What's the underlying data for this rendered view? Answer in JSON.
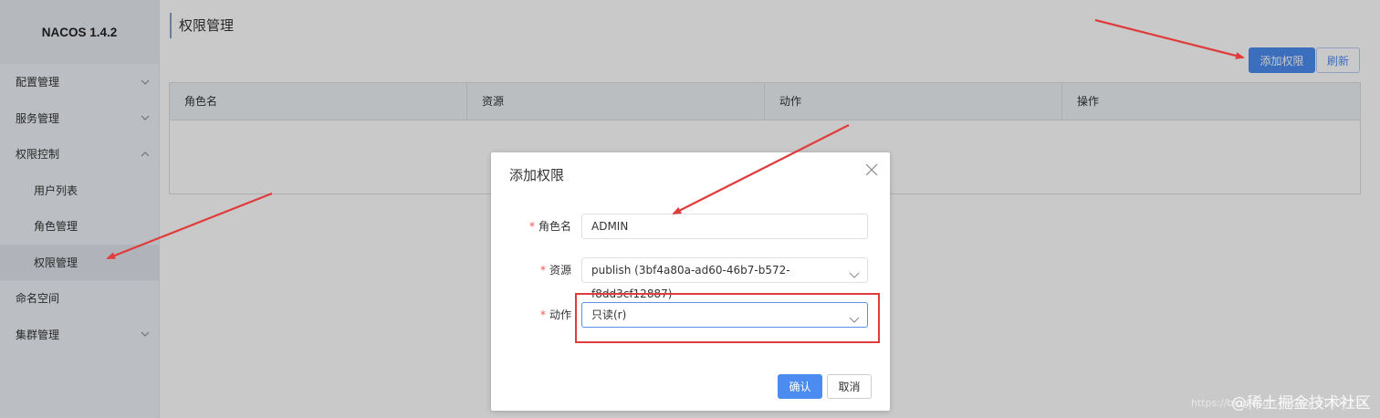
{
  "sidebar": {
    "brand": "NACOS 1.4.2",
    "menu": [
      {
        "label": "配置管理",
        "icon": "chevron-down-icon"
      },
      {
        "label": "服务管理",
        "icon": "chevron-down-icon"
      },
      {
        "label": "权限控制",
        "icon": "chevron-up-icon"
      }
    ],
    "submenu": [
      {
        "label": "用户列表"
      },
      {
        "label": "角色管理"
      },
      {
        "label": "权限管理",
        "active": true
      }
    ],
    "menu_after": [
      {
        "label": "命名空间"
      },
      {
        "label": "集群管理",
        "icon": "chevron-down-icon"
      }
    ]
  },
  "main": {
    "title": "权限管理",
    "add_button": "添加权限",
    "refresh_button": "刷新",
    "table": {
      "columns": [
        "角色名",
        "资源",
        "动作",
        "操作"
      ]
    }
  },
  "dialog": {
    "title": "添加权限",
    "fields": {
      "role": {
        "label": "角色名",
        "value": "ADMIN"
      },
      "resource": {
        "label": "资源",
        "value": "publish (3bf4a80a-ad60-46b7-b572-f8dd3cf12887)"
      },
      "action": {
        "label": "动作",
        "value": "只读(r)"
      }
    },
    "confirm_button": "确认",
    "cancel_button": "取消"
  },
  "watermark": {
    "text": "@稀土掘金技术社区",
    "url": "https://blog.csdn.net/qq_41107231"
  },
  "colors": {
    "primary": "#4c8cf0",
    "annotation": "#e03c3c",
    "required": "#f25353"
  }
}
